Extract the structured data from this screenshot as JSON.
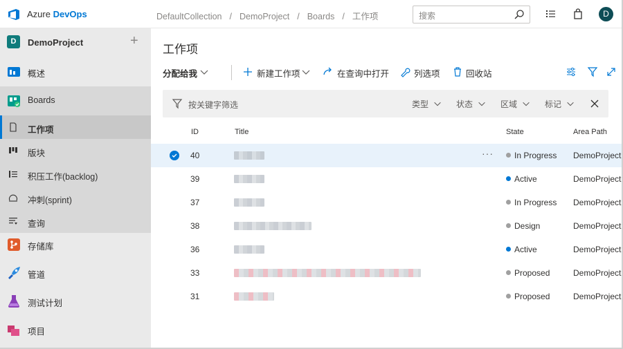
{
  "header": {
    "brand_plain": "Azure ",
    "brand_bold": "DevOps",
    "breadcrumbs": [
      "DefaultCollection",
      "DemoProject",
      "Boards",
      "工作项"
    ],
    "breadcrumb_sep": "/",
    "search_placeholder": "搜索",
    "avatar_initial": "D"
  },
  "sidebar": {
    "project_initial": "D",
    "project_name": "DemoProject",
    "add_symbol": "+",
    "items": [
      {
        "label": "概述",
        "icon": "overview-icon"
      },
      {
        "label": "Boards",
        "icon": "boards-icon"
      },
      {
        "label": "存储库",
        "icon": "repos-icon"
      },
      {
        "label": "管道",
        "icon": "pipelines-icon"
      },
      {
        "label": "测试计划",
        "icon": "test-plans-icon"
      },
      {
        "label": "项目",
        "icon": "artifacts-icon"
      }
    ],
    "boards_sub": [
      {
        "label": "工作项",
        "icon": "work-items-icon",
        "active": true
      },
      {
        "label": "版块",
        "icon": "board-icon"
      },
      {
        "label": "积压工作(backlog)",
        "icon": "backlog-icon"
      },
      {
        "label": "冲刺(sprint)",
        "icon": "sprint-icon"
      },
      {
        "label": "查询",
        "icon": "queries-icon"
      }
    ]
  },
  "main": {
    "title": "工作项",
    "toolbar": {
      "assigned": "分配给我",
      "new_item": "新建工作项",
      "open_query": "在查询中打开",
      "column_options": "列选项",
      "recycle_bin": "回收站"
    },
    "filter": {
      "placeholder": "按关键字筛选",
      "type": "类型",
      "state": "状态",
      "area": "区域",
      "tags": "标记"
    },
    "columns": {
      "id": "ID",
      "title": "Title",
      "state": "State",
      "area": "Area Path"
    },
    "more_symbol": "···",
    "rows": [
      {
        "id": "40",
        "state": "In Progress",
        "area": "DemoProject",
        "selected": true
      },
      {
        "id": "39",
        "state": "Active",
        "area": "DemoProject"
      },
      {
        "id": "37",
        "state": "In Progress",
        "area": "DemoProject"
      },
      {
        "id": "38",
        "state": "Design",
        "area": "DemoProject"
      },
      {
        "id": "36",
        "state": "Active",
        "area": "DemoProject"
      },
      {
        "id": "33",
        "state": "Proposed",
        "area": "DemoProject"
      },
      {
        "id": "31",
        "state": "Proposed",
        "area": "DemoProject"
      }
    ],
    "state_colors": {
      "In Progress": "#a0a0a0",
      "Active": "#0078d4",
      "Design": "#a0a0a0",
      "Proposed": "#a0a0a0"
    }
  },
  "colors": {
    "accent": "#0078d4",
    "sidebar_bg": "#eaeaea",
    "selected_row": "#e8f2fb"
  }
}
